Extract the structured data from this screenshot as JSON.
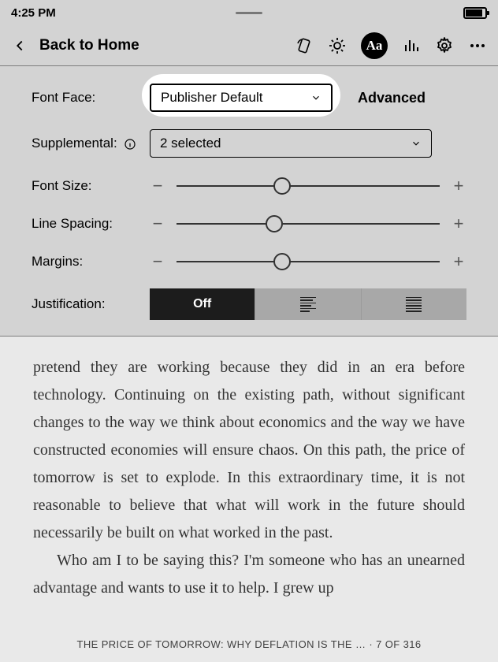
{
  "status": {
    "time": "4:25 PM"
  },
  "toolbar": {
    "back": "Back to Home"
  },
  "settings": {
    "fontface_label": "Font Face:",
    "fontface_value": "Publisher Default",
    "advanced": "Advanced",
    "supplemental_label": "Supplemental:",
    "supplemental_value": "2 selected",
    "fontsize_label": "Font Size:",
    "linespacing_label": "Line Spacing:",
    "margins_label": "Margins:",
    "justification_label": "Justification:",
    "justification_off": "Off",
    "sliders": {
      "fontsize_pct": 40,
      "linespacing_pct": 37,
      "margins_pct": 40
    }
  },
  "book": {
    "para1": "pretend they are working because they did in an era before technology. Continuing on the existing path, without significant changes to the way we think about economics and the way we have constructed economies will ensure chaos. On this path, the price of tomorrow is set to explode. In this extraordinary time, it is not reasonable to believe that what will work in the future should necessarily be built on what worked in the past.",
    "para2": "Who am I to be saying this? I'm someone who has an unearned advantage and wants to use it to help. I grew up",
    "footer": "THE PRICE OF TOMORROW: WHY DEFLATION IS THE … · 7 OF 316"
  }
}
